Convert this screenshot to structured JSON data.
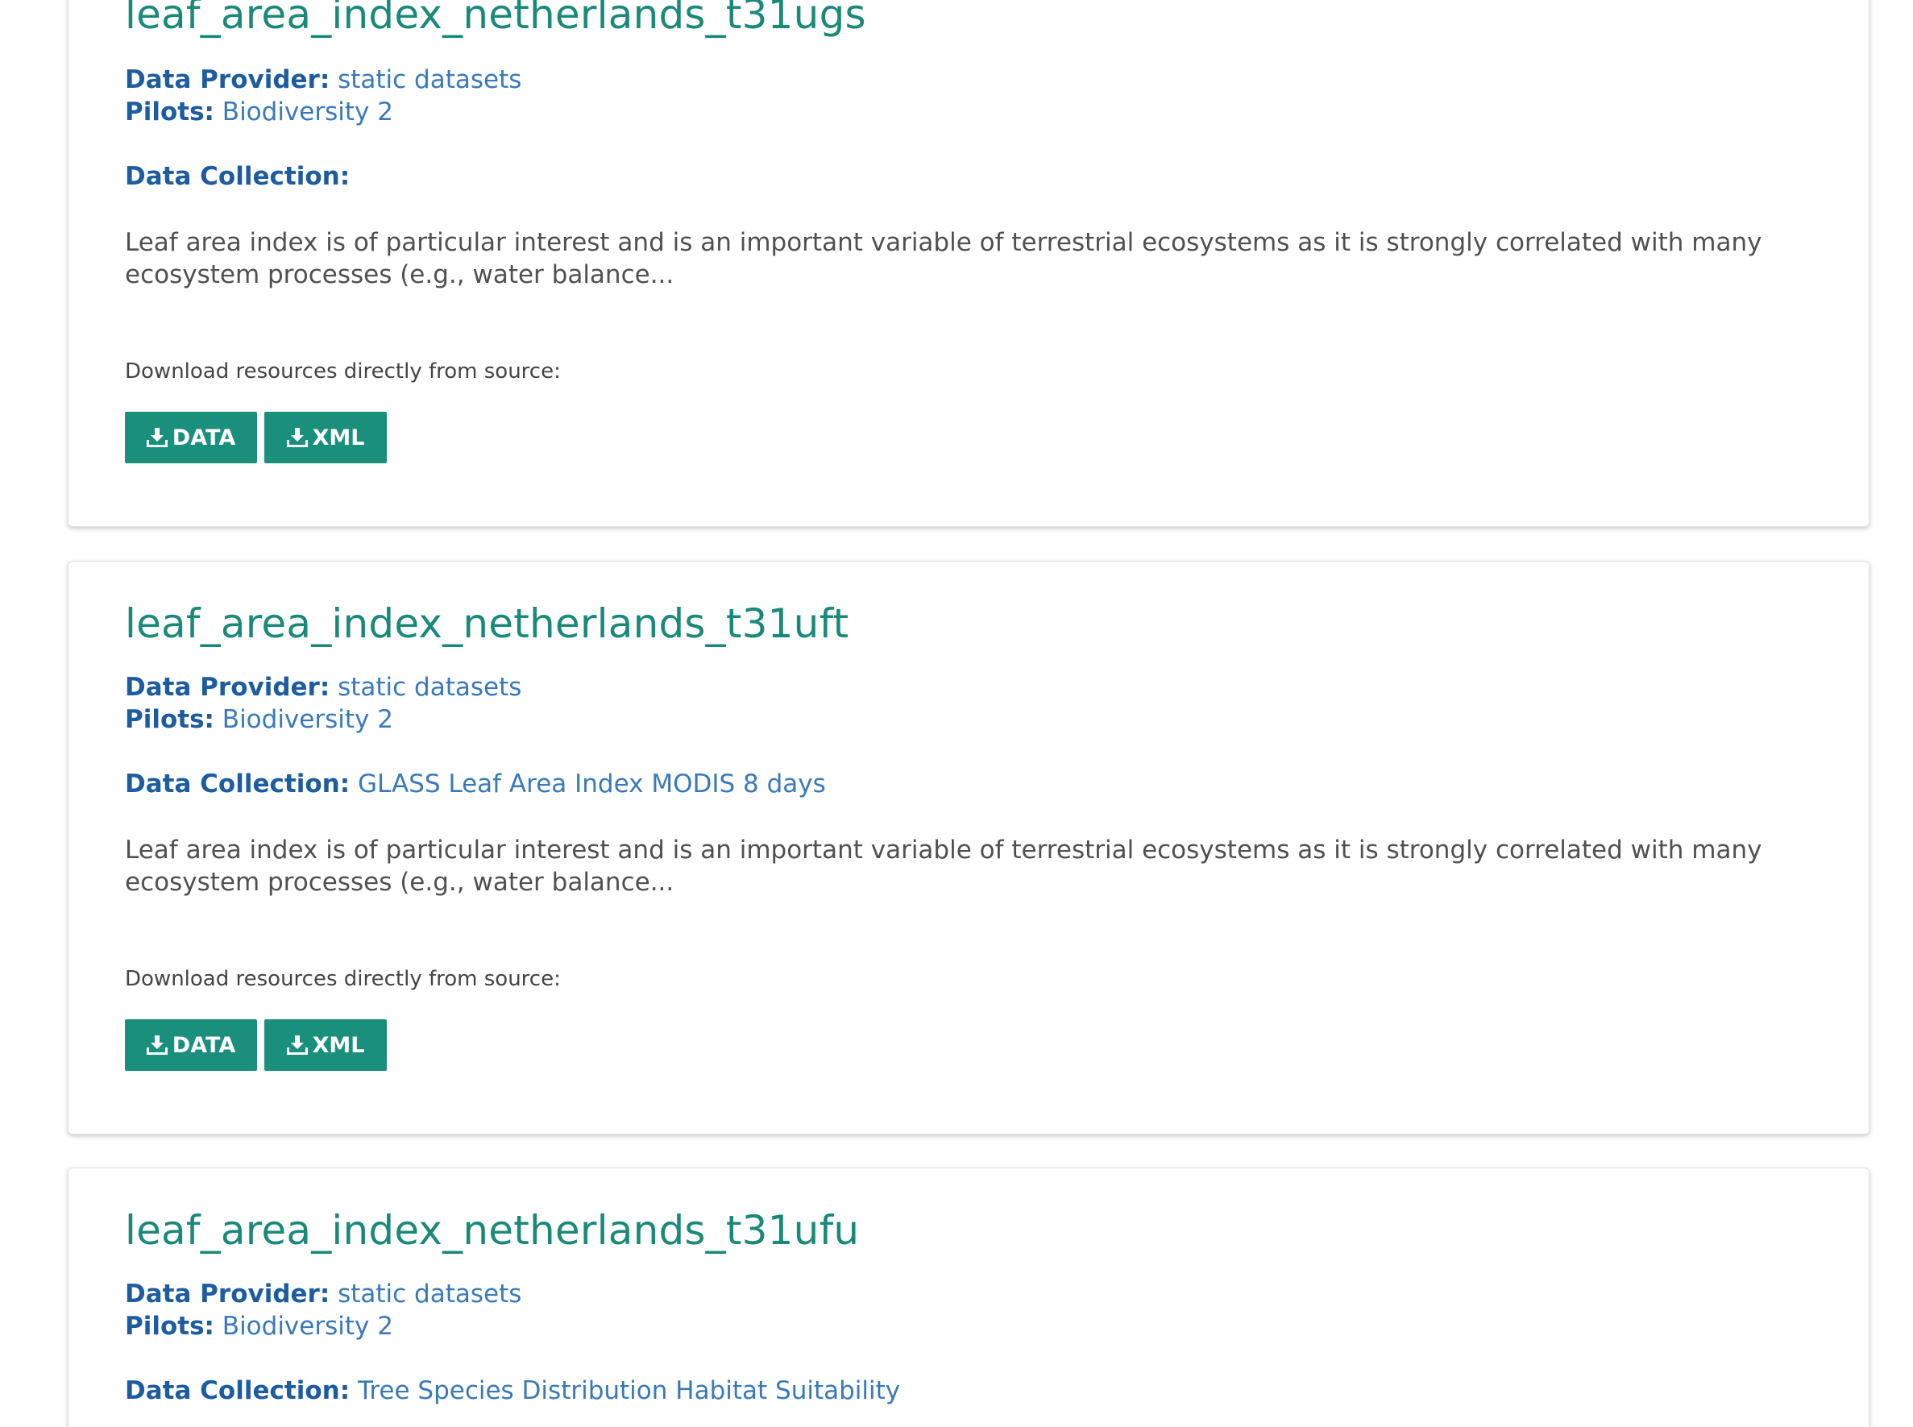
{
  "labels": {
    "provider": "Data Provider:",
    "pilots": "Pilots:",
    "collection": "Data Collection:",
    "download": "Download resources directly from source:"
  },
  "buttons": {
    "data": "DATA",
    "xml": "XML"
  },
  "datasets": [
    {
      "title": "leaf_area_index_netherlands_t31ugs",
      "provider": "static datasets",
      "pilots": "Biodiversity 2",
      "collection": "",
      "description": "Leaf area index is of particular interest and is an important variable of terrestrial ecosystems as it is strongly correlated with many ecosystem processes (e.g., water balance..."
    },
    {
      "title": "leaf_area_index_netherlands_t31uft",
      "provider": "static datasets",
      "pilots": "Biodiversity 2",
      "collection": "GLASS Leaf Area Index MODIS 8 days",
      "description": "Leaf area index is of particular interest and is an important variable of terrestrial ecosystems as it is strongly correlated with many ecosystem processes (e.g., water balance..."
    },
    {
      "title": "leaf_area_index_netherlands_t31ufu",
      "provider": "static datasets",
      "pilots": "Biodiversity 2",
      "collection": "Tree Species Distribution Habitat Suitability"
    }
  ],
  "colors": {
    "title": "#1a8a78",
    "label": "#1d5c9e",
    "link": "#3a79b8",
    "button": "#1a8f7c"
  },
  "icons": {
    "download": "download-icon"
  }
}
